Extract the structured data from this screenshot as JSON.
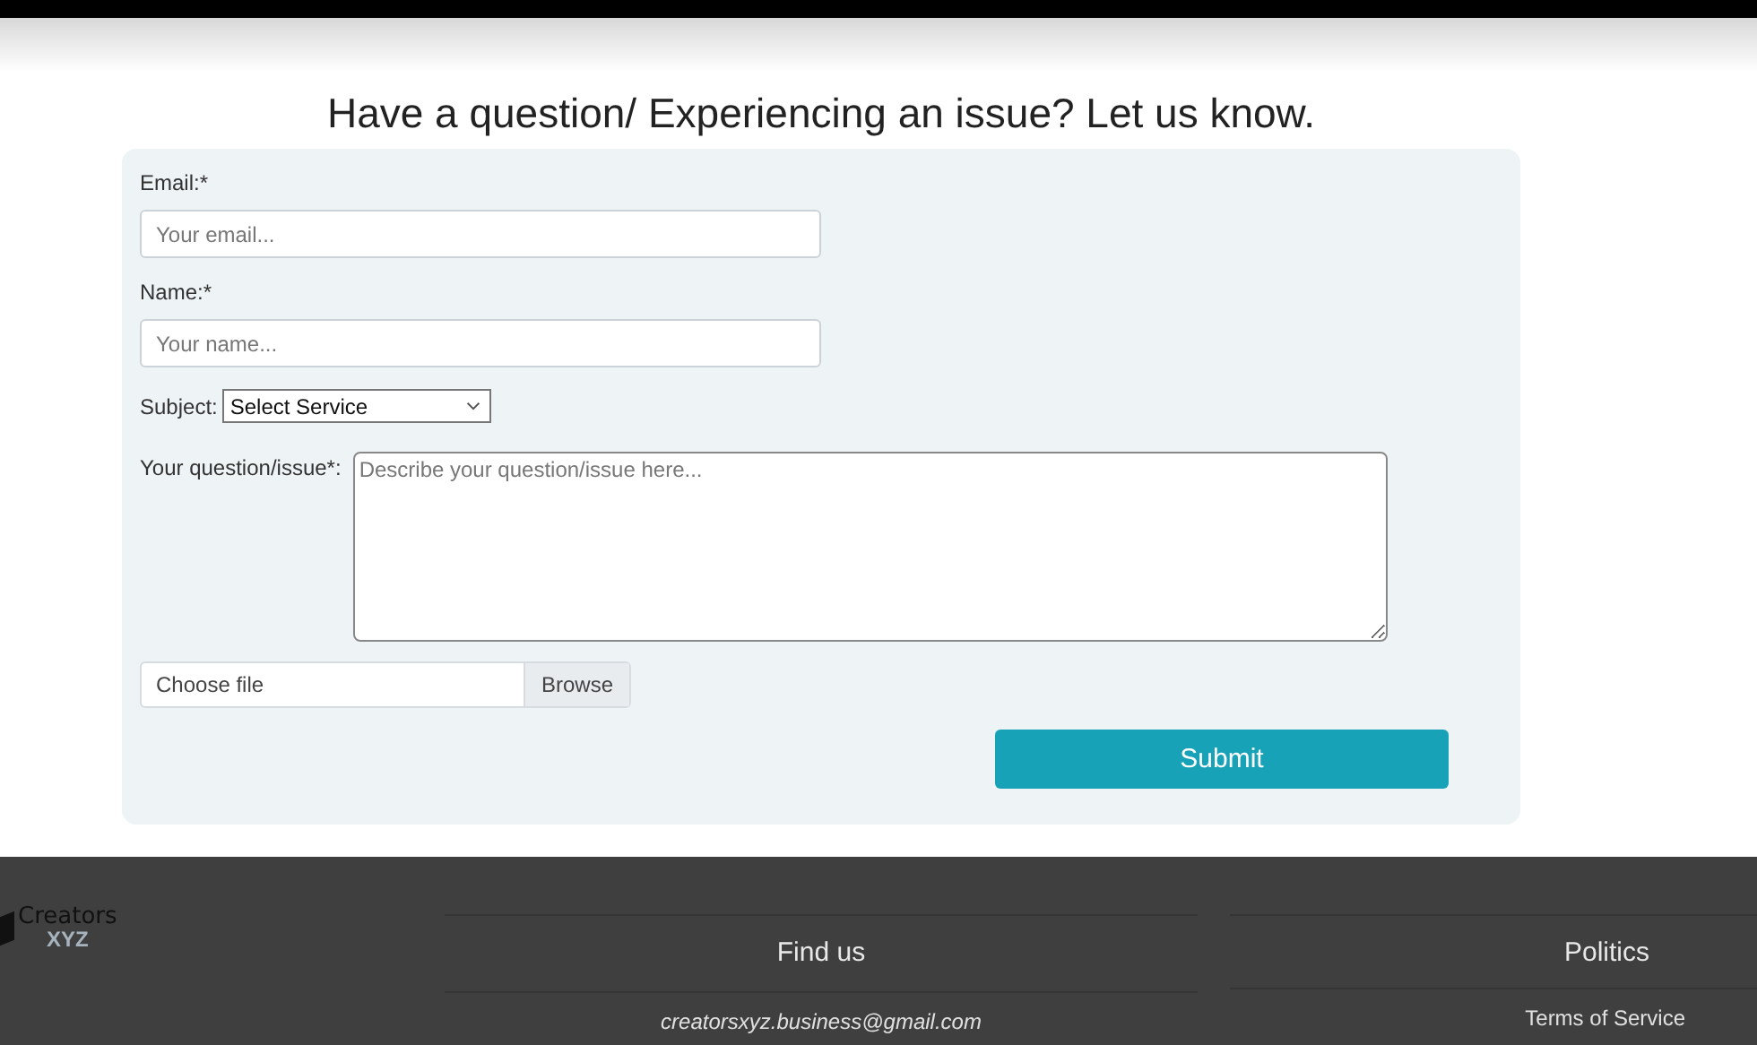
{
  "heading": "Have a question/ Experiencing an issue? Let us know.",
  "form": {
    "email": {
      "label": "Email:*",
      "placeholder": "Your email..."
    },
    "name": {
      "label": "Name:*",
      "placeholder": "Your name..."
    },
    "subject": {
      "label": "Subject:",
      "value": "Select Service"
    },
    "question": {
      "label": "Your question/issue*:",
      "placeholder": "Describe your question/issue here..."
    },
    "file": {
      "placeholder": "Choose file",
      "button": "Browse"
    },
    "submit": "Submit"
  },
  "footer": {
    "logo": {
      "line_1": "Creators",
      "line_2": "XYZ"
    },
    "columns": [
      {
        "title": "Find us",
        "link": "creatorsxyz.business@gmail.com",
        "italic": true
      },
      {
        "title": "Politics",
        "link": "Terms of Service",
        "italic": false
      }
    ]
  }
}
